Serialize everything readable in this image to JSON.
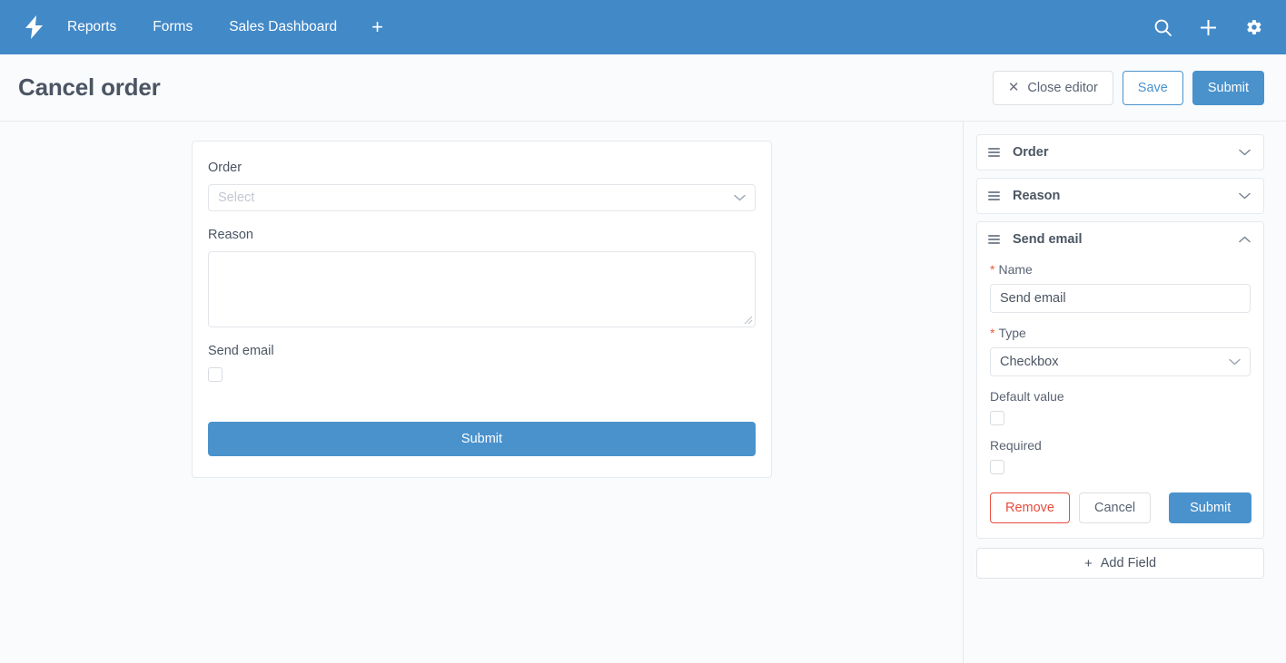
{
  "topnav": {
    "logo_icon": "lightning-bolt-icon",
    "links": [
      {
        "label": "Reports"
      },
      {
        "label": "Forms"
      },
      {
        "label": "Sales Dashboard"
      }
    ],
    "add_tab_label": "+",
    "icons": [
      {
        "name": "search-icon"
      },
      {
        "name": "plus-icon"
      },
      {
        "name": "gear-icon"
      }
    ]
  },
  "header": {
    "title": "Cancel order",
    "close_editor_label": "Close editor",
    "close_editor_icon": "close-x-icon",
    "save_label": "Save",
    "submit_label": "Submit"
  },
  "form_preview": {
    "fields": [
      {
        "label": "Order",
        "type": "select",
        "placeholder": "Select",
        "value": ""
      },
      {
        "label": "Reason",
        "type": "textarea",
        "value": ""
      },
      {
        "label": "Send email",
        "type": "checkbox",
        "checked": false
      }
    ],
    "submit_label": "Submit"
  },
  "sidebar": {
    "accordion": [
      {
        "label": "Order",
        "expanded": false,
        "chevron": "chevron-down-icon"
      },
      {
        "label": "Reason",
        "expanded": false,
        "chevron": "chevron-down-icon"
      },
      {
        "label": "Send email",
        "expanded": true,
        "chevron": "chevron-up-icon"
      }
    ],
    "field_editor": {
      "name_label": "Name",
      "name_required": "*",
      "name_value": "Send email",
      "type_label": "Type",
      "type_required": "*",
      "type_value": "Checkbox",
      "default_value_label": "Default value",
      "default_value_checked": false,
      "required_label": "Required",
      "required_checked": false,
      "remove_label": "Remove",
      "cancel_label": "Cancel",
      "submit_label": "Submit"
    },
    "add_field_label": "Add Field",
    "add_field_icon": "plus-icon"
  },
  "colors": {
    "nav_blue": "#4289c8",
    "accent_blue": "#4a92cc",
    "danger_red": "#e74c3c",
    "required_star": "#e8603c",
    "page_bg": "#fafbfc",
    "text_slate": "#4b5563"
  }
}
